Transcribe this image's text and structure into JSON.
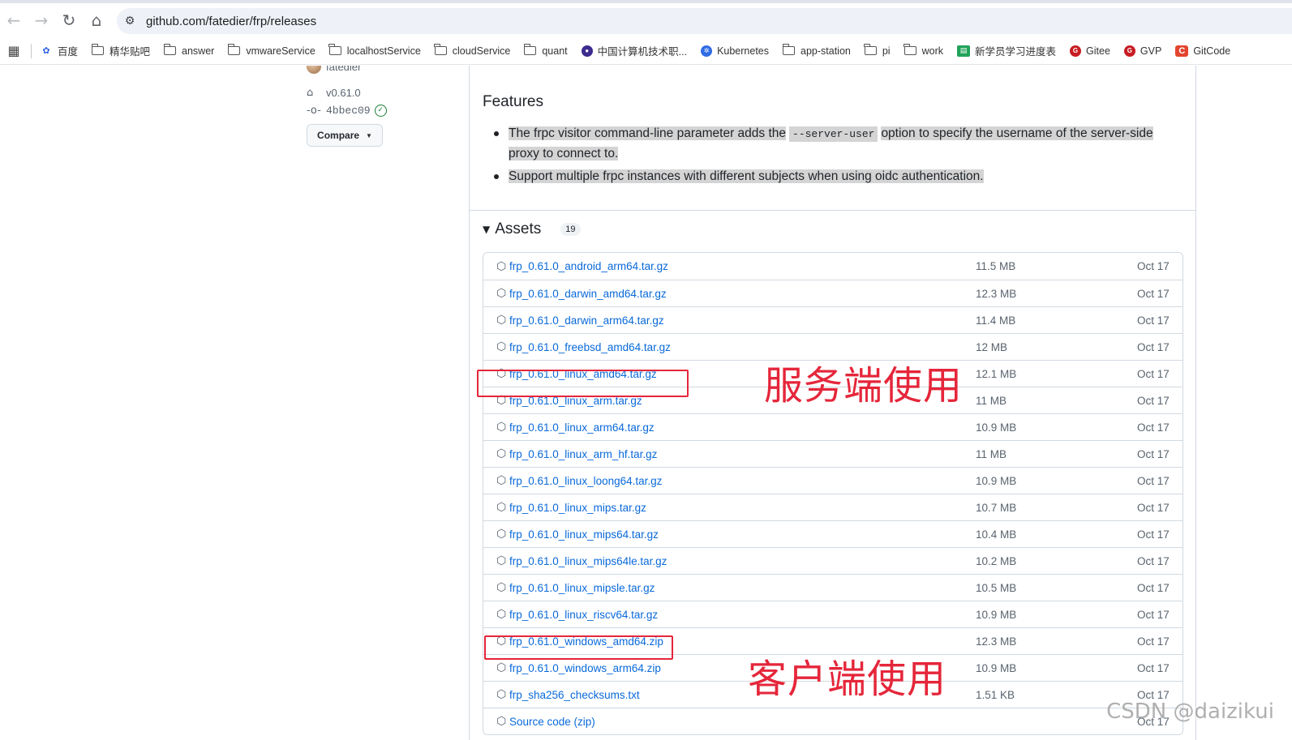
{
  "browser": {
    "url": "github.com/fatedier/frp/releases",
    "bookmarks": [
      {
        "label": "百度",
        "icon": "baidu-icon"
      },
      {
        "label": "精华贴吧",
        "icon": "folder-icon"
      },
      {
        "label": "answer",
        "icon": "folder-icon"
      },
      {
        "label": "vmwareService",
        "icon": "folder-icon"
      },
      {
        "label": "localhostService",
        "icon": "folder-icon"
      },
      {
        "label": "cloudService",
        "icon": "folder-icon"
      },
      {
        "label": "quant",
        "icon": "folder-icon"
      },
      {
        "label": "中国计算机技术职...",
        "icon": "site-icon"
      },
      {
        "label": "Kubernetes",
        "icon": "kubernetes-icon"
      },
      {
        "label": "app-station",
        "icon": "folder-icon"
      },
      {
        "label": "pi",
        "icon": "folder-icon"
      },
      {
        "label": "work",
        "icon": "folder-icon"
      },
      {
        "label": "新学员学习进度表",
        "icon": "sheet-icon"
      },
      {
        "label": "Gitee",
        "icon": "gitee-icon"
      },
      {
        "label": "GVP",
        "icon": "gitee-icon"
      },
      {
        "label": "GitCode",
        "icon": "gitcode-icon"
      }
    ]
  },
  "sidebar": {
    "author": "fatedier",
    "tag": "v0.61.0",
    "commit": "4bbec09",
    "compare_label": "Compare"
  },
  "release": {
    "features_title": "Features",
    "feature_1_pre": "The frpc visitor command-line parameter adds the",
    "feature_1_code": "--server-user",
    "feature_1_post": "option to specify the username of the server-side proxy to connect to.",
    "feature_2": "Support multiple frpc instances with different subjects when using oidc authentication.",
    "assets_title": "Assets",
    "assets_count": "19"
  },
  "assets": [
    {
      "name": "frp_0.61.0_android_arm64.tar.gz",
      "size": "11.5 MB",
      "date": "Oct 17"
    },
    {
      "name": "frp_0.61.0_darwin_amd64.tar.gz",
      "size": "12.3 MB",
      "date": "Oct 17"
    },
    {
      "name": "frp_0.61.0_darwin_arm64.tar.gz",
      "size": "11.4 MB",
      "date": "Oct 17"
    },
    {
      "name": "frp_0.61.0_freebsd_amd64.tar.gz",
      "size": "12 MB",
      "date": "Oct 17"
    },
    {
      "name": "frp_0.61.0_linux_amd64.tar.gz",
      "size": "12.1 MB",
      "date": "Oct 17"
    },
    {
      "name": "frp_0.61.0_linux_arm.tar.gz",
      "size": "11 MB",
      "date": "Oct 17"
    },
    {
      "name": "frp_0.61.0_linux_arm64.tar.gz",
      "size": "10.9 MB",
      "date": "Oct 17"
    },
    {
      "name": "frp_0.61.0_linux_arm_hf.tar.gz",
      "size": "11 MB",
      "date": "Oct 17"
    },
    {
      "name": "frp_0.61.0_linux_loong64.tar.gz",
      "size": "10.9 MB",
      "date": "Oct 17"
    },
    {
      "name": "frp_0.61.0_linux_mips.tar.gz",
      "size": "10.7 MB",
      "date": "Oct 17"
    },
    {
      "name": "frp_0.61.0_linux_mips64.tar.gz",
      "size": "10.4 MB",
      "date": "Oct 17"
    },
    {
      "name": "frp_0.61.0_linux_mips64le.tar.gz",
      "size": "10.2 MB",
      "date": "Oct 17"
    },
    {
      "name": "frp_0.61.0_linux_mipsle.tar.gz",
      "size": "10.5 MB",
      "date": "Oct 17"
    },
    {
      "name": "frp_0.61.0_linux_riscv64.tar.gz",
      "size": "10.9 MB",
      "date": "Oct 17"
    },
    {
      "name": "frp_0.61.0_windows_amd64.zip",
      "size": "12.3 MB",
      "date": "Oct 17"
    },
    {
      "name": "frp_0.61.0_windows_arm64.zip",
      "size": "10.9 MB",
      "date": "Oct 17"
    },
    {
      "name": "frp_sha256_checksums.txt",
      "size": "1.51 KB",
      "date": "Oct 17"
    },
    {
      "name": "Source code (zip)",
      "size": "",
      "date": "Oct 17"
    }
  ],
  "annotations": {
    "server_label": "服务端使用",
    "client_label": "客户端使用",
    "color": "#e5263a"
  },
  "watermark": "CSDN @daizikui"
}
